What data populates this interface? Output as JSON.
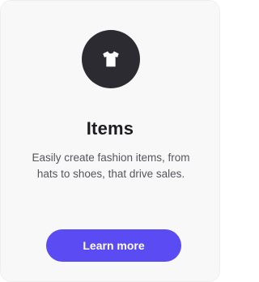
{
  "card": {
    "icon": "tshirt-icon",
    "title": "Items",
    "description": "Easily create fashion items, from hats to shoes, that drive sales.",
    "button_label": "Learn more"
  },
  "colors": {
    "card_background": "#f8f8f9",
    "icon_circle": "#2b2b31",
    "icon_glyph": "#ffffff",
    "button_background": "#5a4bf3",
    "button_text": "#ffffff",
    "title_text": "#1c1c22",
    "description_text": "#55555c"
  }
}
